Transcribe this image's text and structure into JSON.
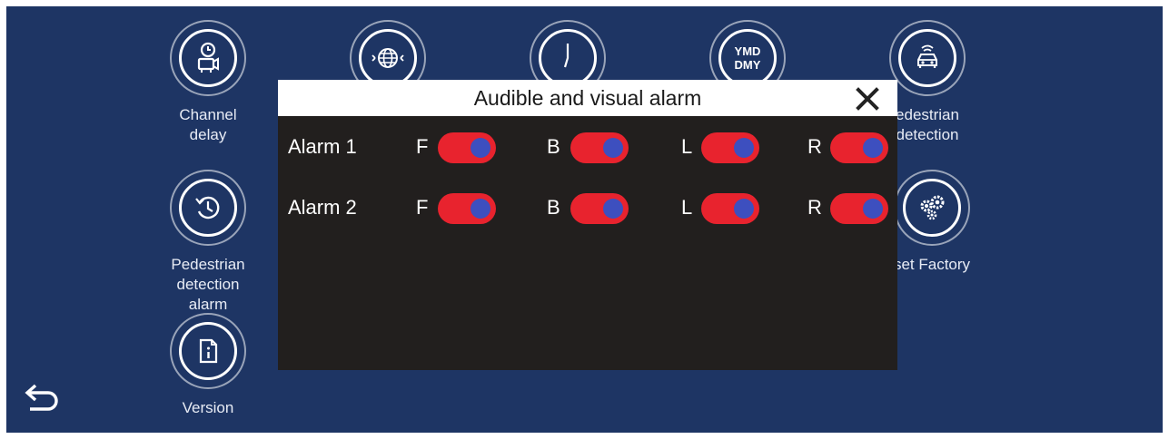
{
  "menu": {
    "items": [
      {
        "id": "channel-delay",
        "label": "Channel delay",
        "icon": "clock-camera-icon"
      },
      {
        "id": "language",
        "label": "",
        "icon": "globe-icon"
      },
      {
        "id": "time",
        "label": "",
        "icon": "clock-hand-icon"
      },
      {
        "id": "date-format",
        "label": "",
        "icon": "date-format-icon",
        "icon_text_top": "YMD",
        "icon_text_bottom": "DMY"
      },
      {
        "id": "pedestrian-detection",
        "label": "edestrian\ndetection",
        "icon": "car-radar-icon"
      },
      {
        "id": "pedestrian-detection-alarm",
        "label": "Pedestrian\ndetection alarm",
        "icon": "history-clock-icon"
      },
      {
        "id": "reset-factory",
        "label": "set Factory",
        "icon": "gears-icon"
      },
      {
        "id": "version",
        "label": "Version",
        "icon": "info-document-icon"
      }
    ]
  },
  "dialog": {
    "title": "Audible and visual alarm",
    "rows": [
      {
        "label": "Alarm 1",
        "channels": [
          {
            "name": "F",
            "on": true
          },
          {
            "name": "B",
            "on": true
          },
          {
            "name": "L",
            "on": true
          },
          {
            "name": "R",
            "on": true
          }
        ]
      },
      {
        "label": "Alarm 2",
        "channels": [
          {
            "name": "F",
            "on": true
          },
          {
            "name": "B",
            "on": true
          },
          {
            "name": "L",
            "on": true
          },
          {
            "name": "R",
            "on": true
          }
        ]
      }
    ]
  },
  "colors": {
    "background": "#1e3564",
    "dialog_body": "#221f1e",
    "toggle_track": "#e8232e",
    "toggle_knob": "#3d4fbf"
  }
}
